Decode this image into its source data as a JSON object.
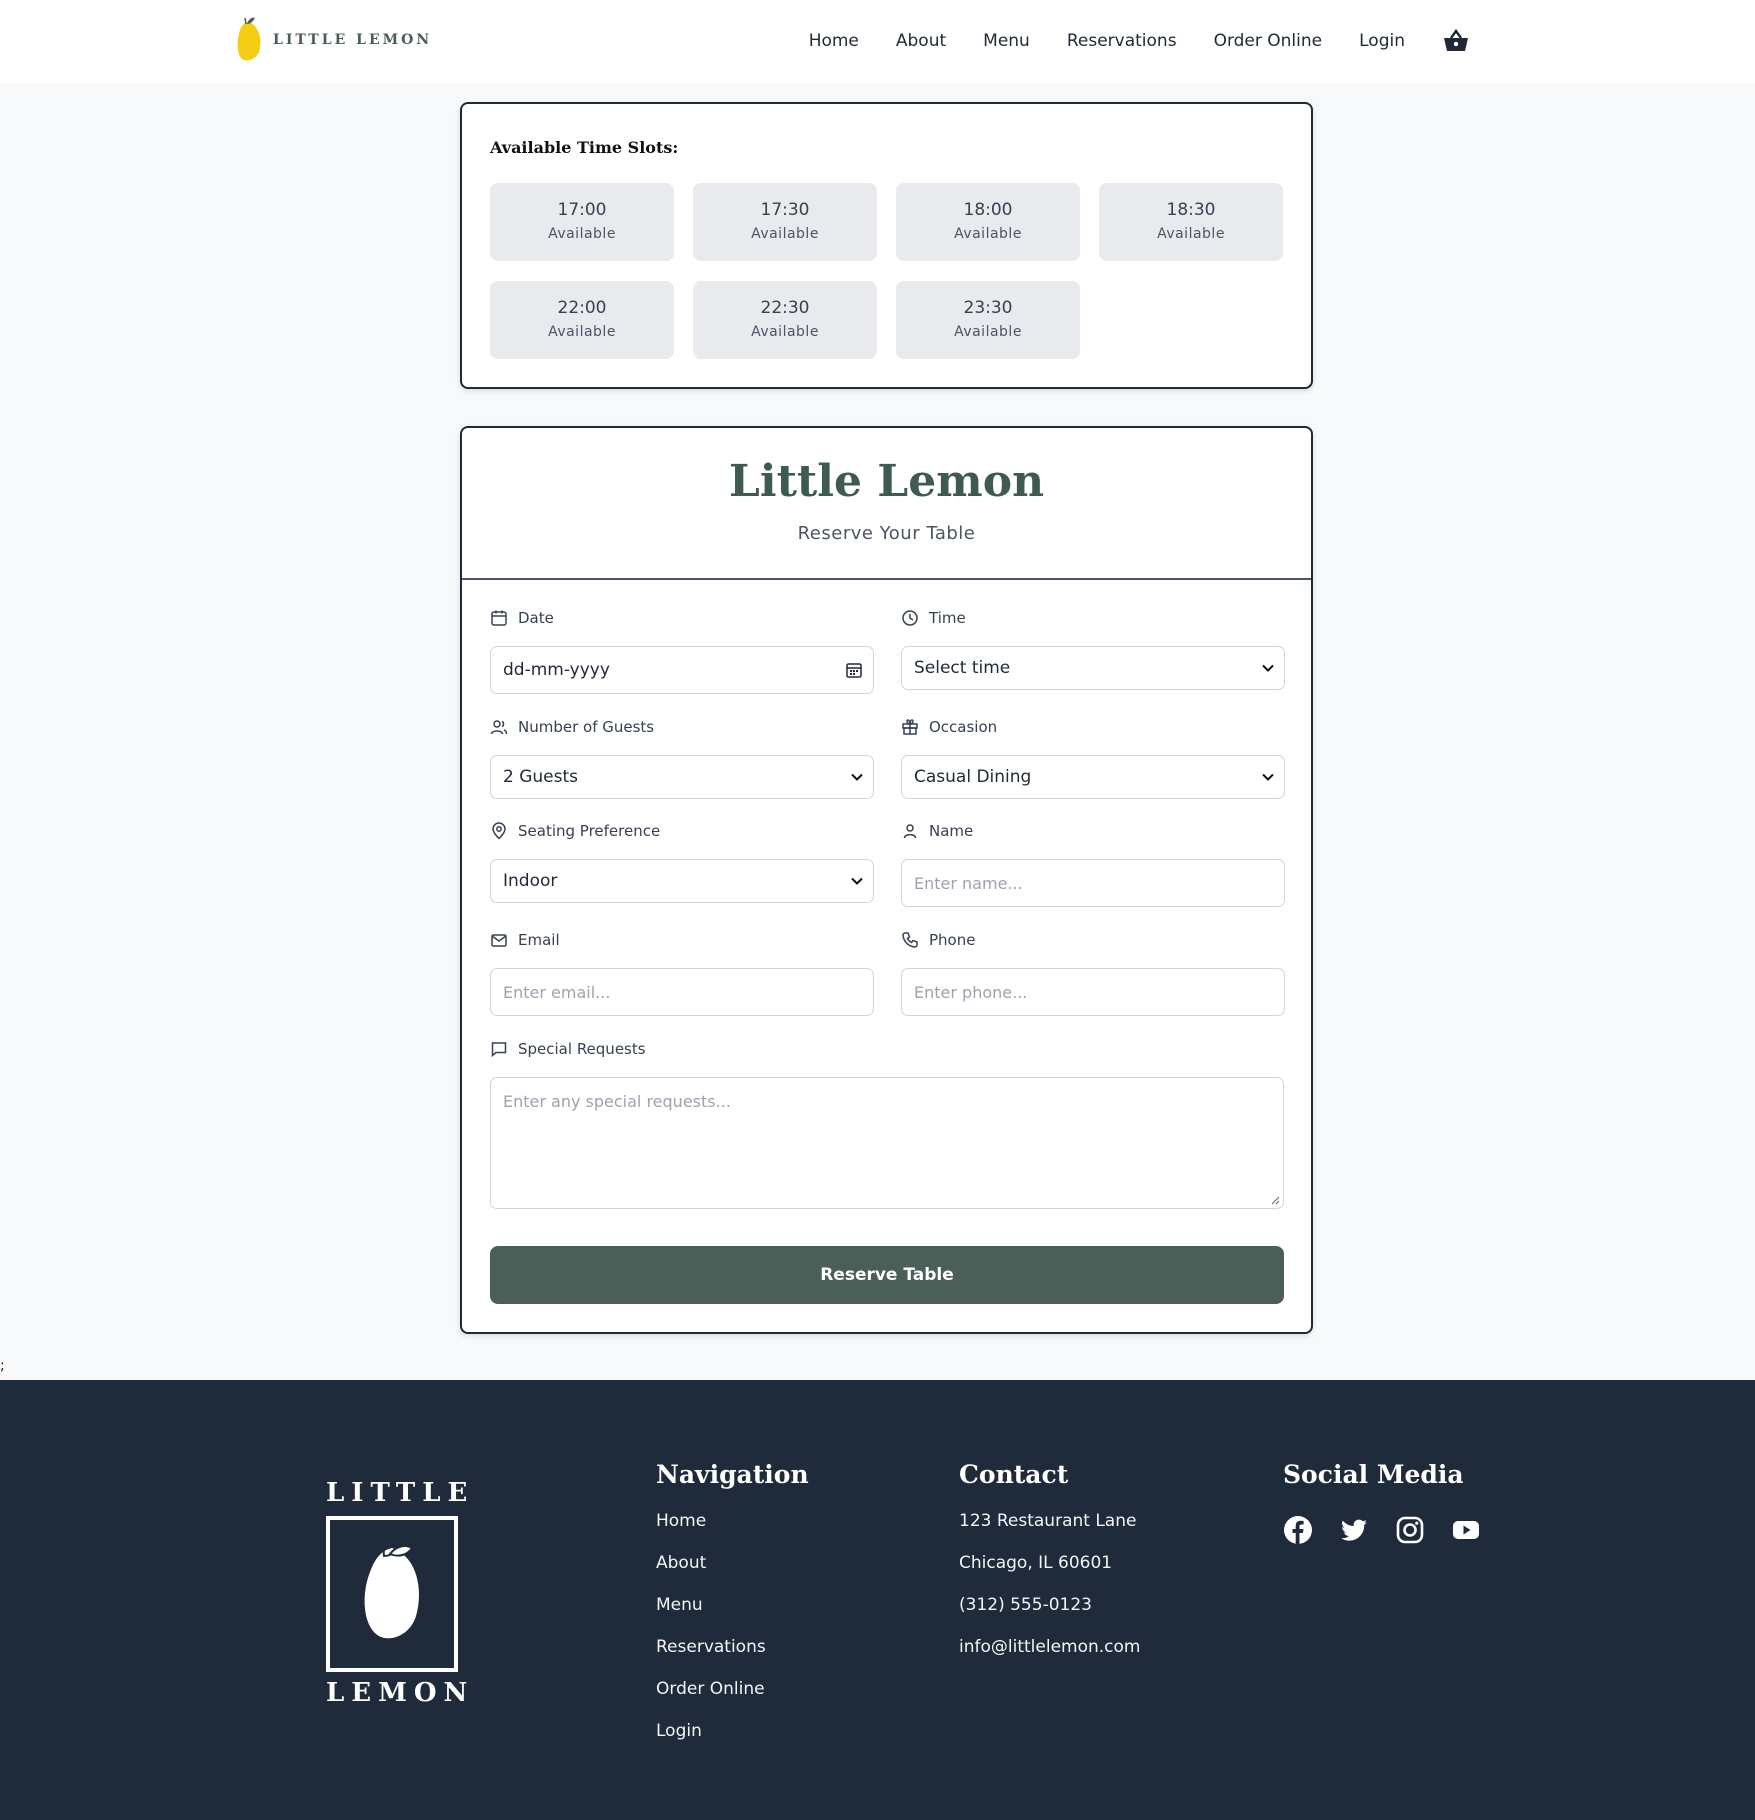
{
  "header": {
    "logo_text": "LITTLE LEMON",
    "nav": [
      "Home",
      "About",
      "Menu",
      "Reservations",
      "Order Online",
      "Login"
    ]
  },
  "slots": {
    "title": "Available Time Slots:",
    "items": [
      {
        "time": "17:00",
        "status": "Available"
      },
      {
        "time": "17:30",
        "status": "Available"
      },
      {
        "time": "18:00",
        "status": "Available"
      },
      {
        "time": "18:30",
        "status": "Available"
      },
      {
        "time": "22:00",
        "status": "Available"
      },
      {
        "time": "22:30",
        "status": "Available"
      },
      {
        "time": "23:30",
        "status": "Available"
      }
    ]
  },
  "form": {
    "title": "Little Lemon",
    "subtitle": "Reserve Your Table",
    "date": {
      "label": "Date",
      "value": "dd-mm-yyyy"
    },
    "time": {
      "label": "Time",
      "value": "Select time"
    },
    "guests": {
      "label": "Number of Guests",
      "value": "2 Guests"
    },
    "occasion": {
      "label": "Occasion",
      "value": "Casual Dining"
    },
    "seating": {
      "label": "Seating Preference",
      "value": "Indoor"
    },
    "name": {
      "label": "Name",
      "placeholder": "Enter name..."
    },
    "email": {
      "label": "Email",
      "placeholder": "Enter email..."
    },
    "phone": {
      "label": "Phone",
      "placeholder": "Enter phone..."
    },
    "requests": {
      "label": "Special Requests",
      "placeholder": "Enter any special requests..."
    },
    "submit_label": "Reserve Table"
  },
  "stray_text": ";",
  "footer": {
    "logo_top": "LITTLE",
    "logo_bottom": "LEMON",
    "navigation": {
      "title": "Navigation",
      "items": [
        "Home",
        "About",
        "Menu",
        "Reservations",
        "Order Online",
        "Login"
      ]
    },
    "contact": {
      "title": "Contact",
      "items": [
        "123 Restaurant Lane",
        "Chicago, IL 60601",
        "(312) 555-0123",
        "info@littlelemon.com"
      ]
    },
    "social": {
      "title": "Social Media",
      "icons": [
        "facebook-icon",
        "twitter-icon",
        "instagram-icon",
        "youtube-icon"
      ]
    }
  },
  "colors": {
    "brand_green": "#495e57",
    "button_green": "#4b5f58",
    "footer_bg": "#1f2a3b",
    "lemon_yellow": "#f4ce14"
  }
}
